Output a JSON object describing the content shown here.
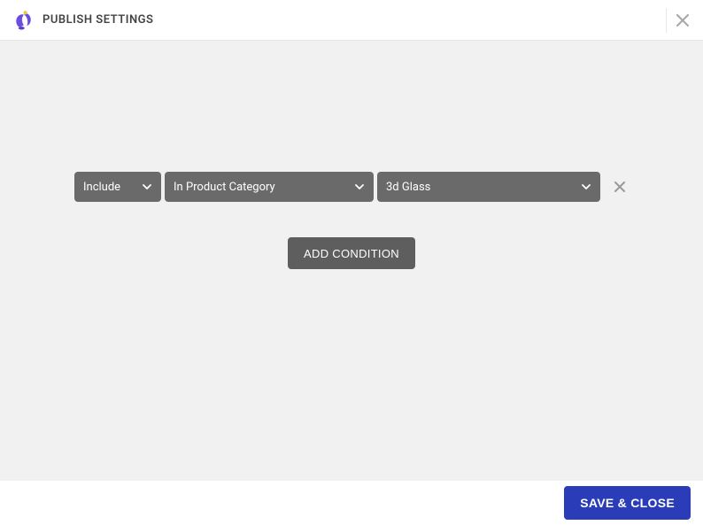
{
  "header": {
    "title": "PUBLISH SETTINGS"
  },
  "condition": {
    "mode": "Include",
    "field": "In Product Category",
    "value": "3d Glass"
  },
  "buttons": {
    "add_condition": "ADD CONDITION",
    "save_close": "SAVE & CLOSE"
  }
}
